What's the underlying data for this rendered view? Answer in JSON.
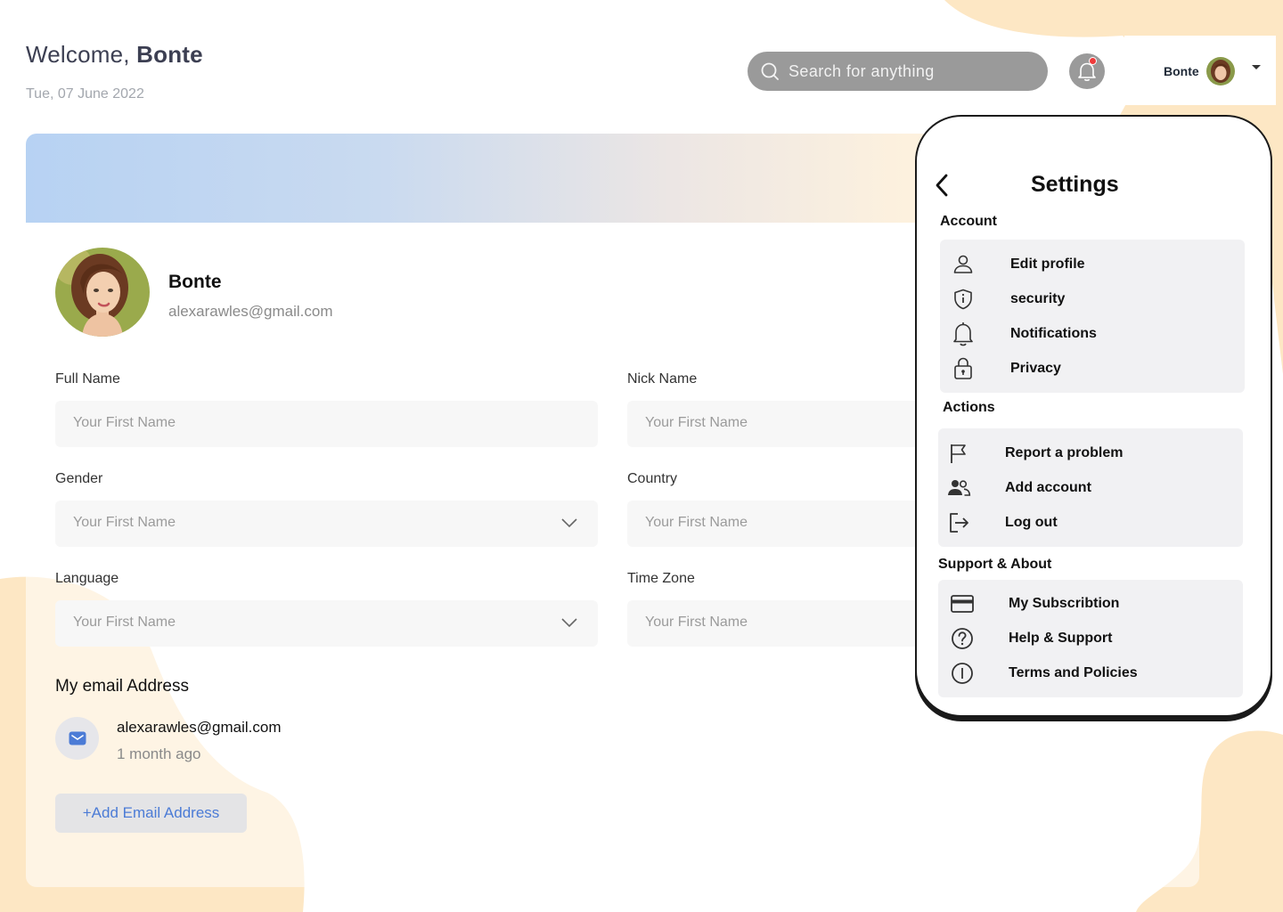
{
  "header": {
    "welcome_prefix": "Welcome, ",
    "welcome_name": "Bonte",
    "date": "Tue, 07 June 2022",
    "search_placeholder": "Search for anything",
    "user_name": "Bonte"
  },
  "profile": {
    "name": "Bonte",
    "email": "alexarawles@gmail.com"
  },
  "form": {
    "full_name": {
      "label": "Full Name",
      "placeholder": "Your First Name"
    },
    "nick_name": {
      "label": "Nick Name",
      "placeholder": "Your First Name"
    },
    "gender": {
      "label": "Gender",
      "placeholder": "Your First Name"
    },
    "country": {
      "label": "Country",
      "placeholder": "Your First Name"
    },
    "language": {
      "label": "Language",
      "placeholder": "Your First Name"
    },
    "time_zone": {
      "label": "Time Zone",
      "placeholder": "Your First Name"
    }
  },
  "emails": {
    "title": "My email Address",
    "items": [
      {
        "address": "alexarawles@gmail.com",
        "time": "1 month ago"
      }
    ],
    "add_label": "+Add Email Address"
  },
  "settings": {
    "title": "Settings",
    "sections": [
      {
        "title": "Account",
        "items": [
          {
            "label": "Edit profile",
            "icon": "user-icon"
          },
          {
            "label": "security",
            "icon": "shield-icon"
          },
          {
            "label": "Notifications",
            "icon": "bell-icon"
          },
          {
            "label": "Privacy",
            "icon": "lock-icon"
          }
        ]
      },
      {
        "title": "Actions",
        "items": [
          {
            "label": "Report a problem",
            "icon": "flag-icon"
          },
          {
            "label": "Add account",
            "icon": "users-icon"
          },
          {
            "label": "Log out",
            "icon": "logout-icon"
          }
        ]
      },
      {
        "title": "Support & About",
        "items": [
          {
            "label": "My Subscribtion",
            "icon": "credit-card-icon"
          },
          {
            "label": "Help & Support",
            "icon": "help-icon"
          },
          {
            "label": "Terms and Policies",
            "icon": "info-icon"
          }
        ]
      }
    ]
  },
  "colors": {
    "accent_blue": "#4b7bd6",
    "blob_peach": "#fde7c4",
    "notification_dot": "#ef3b3b"
  }
}
